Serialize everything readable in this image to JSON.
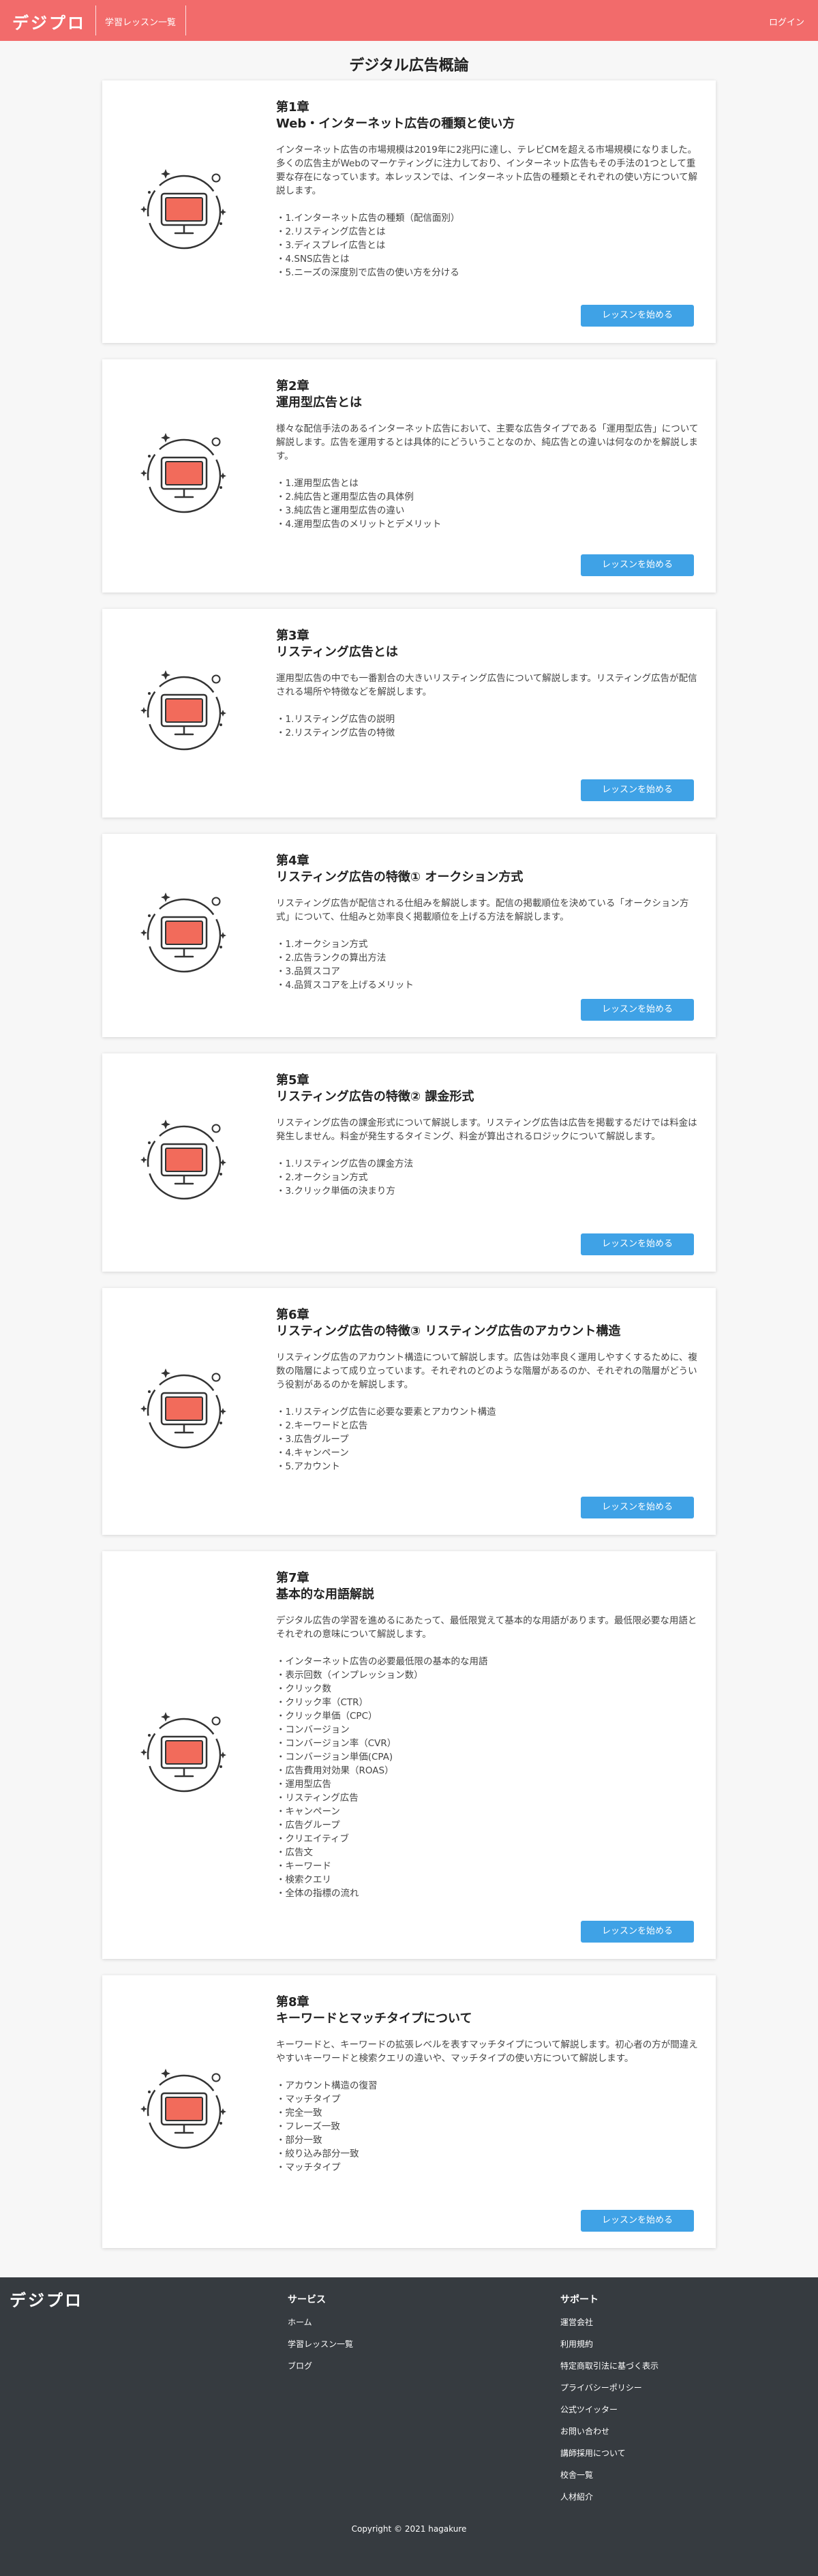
{
  "header": {
    "logo": "デジプロ",
    "nav_link": "学習レッスン一覧",
    "login": "ログイン",
    "color": "#f26b6b"
  },
  "page_title": "デジタル広告概論",
  "lesson_button_label": "レッスンを始める",
  "illustration_icon": "computer-monitor-icon",
  "chapters": [
    {
      "number": "第1章",
      "title": "Web・インターネット広告の種類と使い方",
      "description": "インターネット広告の市場規模は2019年に2兆円に達し、テレビCMを超える市場規模になりました。多くの広告主がWebのマーケティングに注力しており、インターネット広告もその手法の1つとして重要な存在になっています。本レッスンでは、インターネット広告の種類とそれぞれの使い方について解説します。",
      "items": [
        "1.インターネット広告の種類（配信面別）",
        "2.リスティング広告とは",
        "3.ディスプレイ広告とは",
        "4.SNS広告とは",
        "5.ニーズの深度別で広告の使い方を分ける"
      ]
    },
    {
      "number": "第2章",
      "title": "運用型広告とは",
      "description": "様々な配信手法のあるインターネット広告において、主要な広告タイプである「運用型広告」について解説します。広告を運用するとは具体的にどういうことなのか、純広告との違いは何なのかを解説します。",
      "items": [
        "1.運用型広告とは",
        "2.純広告と運用型広告の具体例",
        "3.純広告と運用型広告の違い",
        "4.運用型広告のメリットとデメリット"
      ]
    },
    {
      "number": "第3章",
      "title": "リスティング広告とは",
      "description": "運用型広告の中でも一番割合の大きいリスティング広告について解説します。リスティング広告が配信される場所や特徴などを解説します。",
      "items": [
        "1.リスティング広告の説明",
        "2.リスティング広告の特徴"
      ]
    },
    {
      "number": "第4章",
      "title": "リスティング広告の特徴① オークション方式",
      "description": "リスティング広告が配信される仕組みを解説します。配信の掲載順位を決めている「オークション方式」について、仕組みと効率良く掲載順位を上げる方法を解説します。",
      "items": [
        "1.オークション方式",
        "2.広告ランクの算出方法",
        "3.品質スコア",
        "4.品質スコアを上げるメリット"
      ]
    },
    {
      "number": "第5章",
      "title": "リスティング広告の特徴② 課金形式",
      "description": "リスティング広告の課金形式について解説します。リスティング広告は広告を掲載するだけでは料金は発生しません。料金が発生するタイミング、料金が算出されるロジックについて解説します。",
      "items": [
        "1.リスティング広告の課金方法",
        "2.オークション方式",
        "3.クリック単価の決まり方"
      ]
    },
    {
      "number": "第6章",
      "title": "リスティング広告の特徴③ リスティング広告のアカウント構造",
      "description": "リスティング広告のアカウント構造について解説します。広告は効率良く運用しやすくするために、複数の階層によって成り立っています。それぞれのどのような階層があるのか、それぞれの階層がどういう役割があるのかを解説します。",
      "items": [
        "1.リスティング広告に必要な要素とアカウント構造",
        "2.キーワードと広告",
        "3.広告グループ",
        "4.キャンペーン",
        "5.アカウント"
      ]
    },
    {
      "number": "第7章",
      "title": "基本的な用語解説",
      "description": "デジタル広告の学習を進めるにあたって、最低限覚えて基本的な用語があります。最低限必要な用語とそれぞれの意味について解説します。",
      "items": [
        "インターネット広告の必要最低限の基本的な用語",
        "表示回数（インプレッション数）",
        "クリック数",
        "クリック率（CTR）",
        "クリック単価（CPC）",
        "コンバージョン",
        "コンバージョン率（CVR）",
        "コンバージョン単価(CPA)",
        "広告費用対効果（ROAS）",
        "運用型広告",
        "リスティング広告",
        "キャンペーン",
        "広告グループ",
        "クリエイティブ",
        "広告文",
        "キーワード",
        "検索クエリ",
        "全体の指標の流れ"
      ]
    },
    {
      "number": "第8章",
      "title": "キーワードとマッチタイプについて",
      "description": "キーワードと、キーワードの拡張レベルを表すマッチタイプについて解説します。初心者の方が間違えやすいキーワードと検索クエリの違いや、マッチタイプの使い方について解説します。",
      "items": [
        "アカウント構造の復習",
        "マッチタイプ",
        "完全一致",
        "フレーズ一致",
        "部分一致",
        "絞り込み部分一致",
        "マッチタイプ"
      ]
    }
  ],
  "footer": {
    "logo": "デジプロ",
    "services_heading": "サービス",
    "services": [
      "ホーム",
      "学習レッスン一覧",
      "ブログ"
    ],
    "support_heading": "サポート",
    "support": [
      "運営会社",
      "利用規約",
      "特定商取引法に基づく表示",
      "プライバシーポリシー",
      "公式ツイッター",
      "お問い合わせ",
      "講師採用について",
      "校舎一覧",
      "人材紹介"
    ],
    "copyright": "Copyright © 2021 hagakure"
  }
}
